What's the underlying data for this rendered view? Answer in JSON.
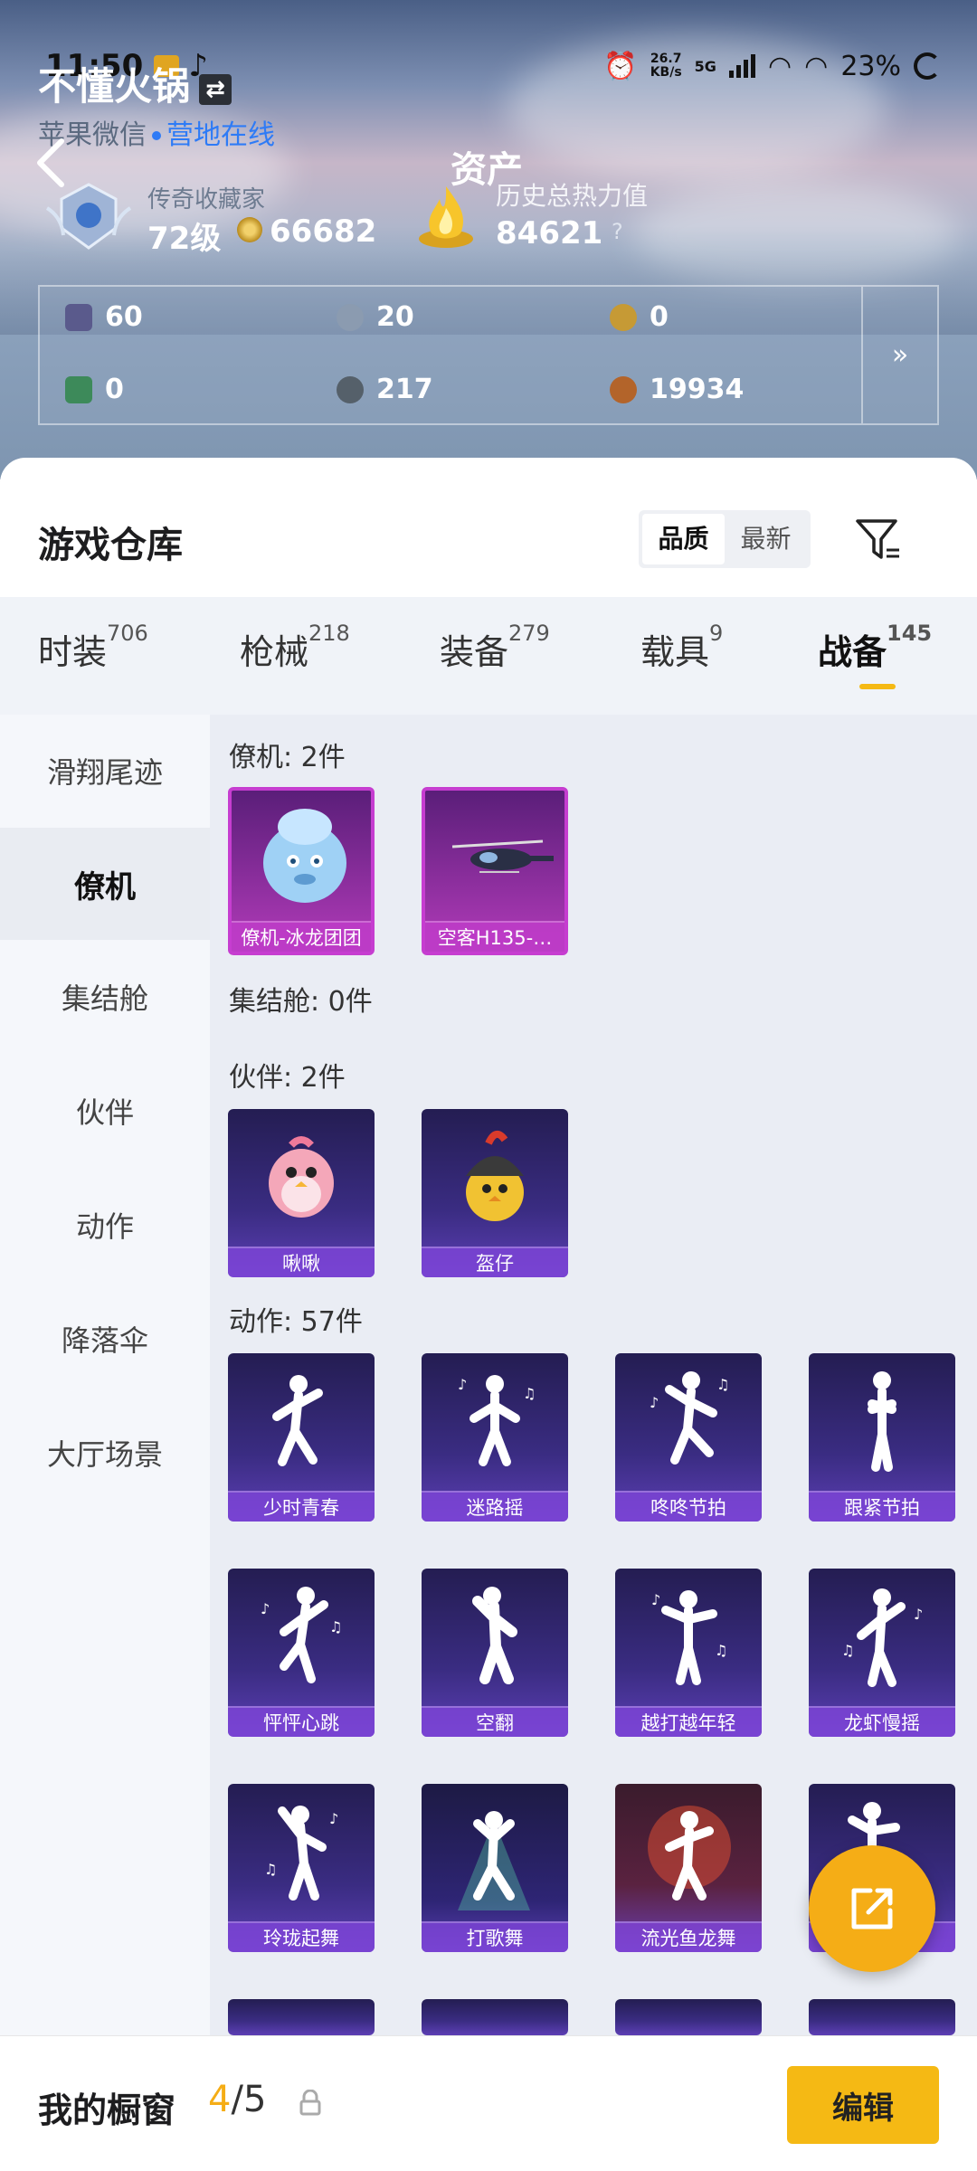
{
  "status": {
    "time": "11:50",
    "net_speed": "26.7",
    "net_unit": "KB/s",
    "net_type": "5G",
    "battery": "23%"
  },
  "profile": {
    "name": "不懂火锅",
    "switch_icon": "⇄",
    "platform": "苹果微信",
    "status_online": "营地在线",
    "rank_label": "传奇收藏家",
    "level": "72级",
    "coins": "66682",
    "assets_title": "资产",
    "heat_label": "历史总热力值",
    "heat_value": "84621",
    "heat_help": "?"
  },
  "stats": [
    {
      "value": "60",
      "icon": "card-icon",
      "color": "#5a5a8c"
    },
    {
      "value": "20",
      "icon": "silver-coin-icon",
      "color": "#8b9bb0"
    },
    {
      "value": "0",
      "icon": "gold-coin-icon",
      "color": "#c69a35"
    },
    {
      "value": "0",
      "icon": "green-card-icon",
      "color": "#3d8a5a"
    },
    {
      "value": "217",
      "icon": "orb-icon",
      "color": "#55606a"
    },
    {
      "value": "19934",
      "icon": "bronze-coin-icon",
      "color": "#b3642a"
    }
  ],
  "stats_more": "»",
  "warehouse": {
    "title": "游戏仓库",
    "sort_quality": "品质",
    "sort_newest": "最新"
  },
  "tabs": [
    {
      "label": "时装",
      "count": "706"
    },
    {
      "label": "枪械",
      "count": "218"
    },
    {
      "label": "装备",
      "count": "279"
    },
    {
      "label": "载具",
      "count": "9"
    },
    {
      "label": "战备",
      "count": "145"
    }
  ],
  "sidebar": [
    "滑翔尾迹",
    "僚机",
    "集结舱",
    "伙伴",
    "动作",
    "降落伞",
    "大厅场景"
  ],
  "sections": {
    "wingman": {
      "title": "僚机: 2件",
      "items": [
        "僚机-冰龙团团",
        "空客H135-…"
      ]
    },
    "capsule": {
      "title": "集结舱: 0件"
    },
    "partner": {
      "title": "伙伴: 2件",
      "items": [
        "啾啾",
        "盔仔"
      ]
    },
    "emote": {
      "title": "动作: 57件",
      "items": [
        "少时青春",
        "迷路摇",
        "咚咚节拍",
        "跟紧节拍",
        "怦怦心跳",
        "空翻",
        "越打越年轻",
        "龙虾慢摇",
        "玲珑起舞",
        "打歌舞",
        "流光鱼龙舞",
        ""
      ]
    }
  },
  "bottom": {
    "showcase_label": "我的橱窗",
    "showcase_current": "4",
    "showcase_sep": "/",
    "showcase_total": "5",
    "edit_label": "编辑"
  },
  "accent": "#f5b914"
}
